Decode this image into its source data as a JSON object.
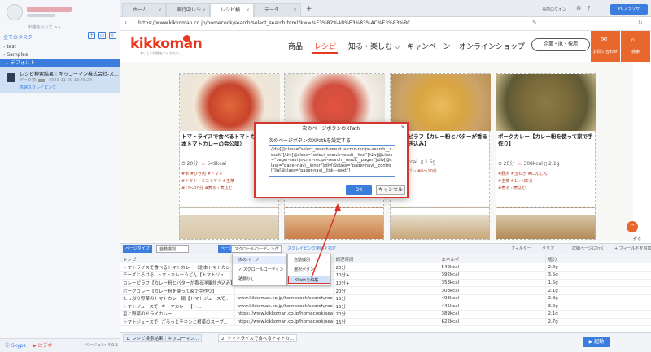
{
  "sidebar": {
    "upgrade": "料金を払って >>",
    "task_header": "全てのタスク",
    "tree": [
      "test",
      "Samples"
    ],
    "group": "デフォルト",
    "task": {
      "name": "レシピ検索結果｜キッコーマン株式会社-ス...",
      "meta_label": "データ数:",
      "date": "2023-11-09 13:45:24",
      "tag": "高速スクレイピング"
    },
    "skype": "Skype",
    "video": "ビデオ",
    "version": "バージョン: 4.0.1"
  },
  "tabs": [
    "ホーム...",
    "実行中レシ...",
    "レシピ検...",
    "データ..."
  ],
  "login": "事前ログイン",
  "pc_browser": "PCブラウザ",
  "url": "https://www.kikkoman.co.jp/homecook/search/select_search.html?kw=%E3%82%AB%E3%83%AC%E3%83%BC",
  "site": {
    "logo": "kikkoman",
    "logo_sub": "おいしい記憶をつくりたい。",
    "nav": [
      "商品",
      "レシピ",
      "知る・楽しむ ⌵",
      "キャンペーン",
      "オンラインショップ"
    ],
    "corp": "企業・IR・採用",
    "contact": "お問い合わせ",
    "search": "検索",
    "cards": [
      {
        "title": "トマトライスで食べるトマトカ...（北本トマトカレーの会公認）",
        "time": "20分",
        "kcal": "549kcal",
        "salt": "",
        "tags": [
          "#米",
          "#ひき肉",
          "#トマト",
          "#トマト・ミニトマト",
          "#主菜",
          "#11〜20分",
          "#煮る・煮込む"
        ],
        "color": "#c8432a"
      },
      {
        "title": "",
        "time": "",
        "kcal": "",
        "salt": "",
        "tags": [],
        "color": "#d24f3d"
      },
      {
        "title": "カレーピラフ【カレー粉とバターが香る洋風炊き込み】",
        "time": "",
        "kcal": "353kcal",
        "salt": "1.5g",
        "tags": [
          "#ご飯・パン",
          "#0〜10分"
        ],
        "color": "#d9a441"
      },
      {
        "title": "ポークカレー【カレー粉を使って家で手作り】",
        "time": "20分",
        "kcal": "308kcal",
        "salt": "2.1g",
        "tags": [
          "#豚肉",
          "#玉ねぎ",
          "#にんじん",
          "#主菜",
          "#11〜20分",
          "#煮る・煮込む"
        ],
        "color": "#7b6a3a"
      }
    ],
    "scroll_top": "^",
    "fold": "折る"
  },
  "dialog": {
    "title": "次のページボタンのXPath",
    "label": "次のページボタンのXPathを設定する",
    "xpath": "//div[@class=\"select_search-result js-cmn-recipe-search__result\"]/div[@class=\"select_search-result__foot\"]/div[@class=\"pager-navi js-cmn-recipe-search__result__pager\"]/div[@class=\"pager-navi__inner\"]/div[@class=\"pager-navi__control\"]/a[@class=\"pager-navi__link --next\"]",
    "ok": "OK",
    "cancel": "キャンセル"
  },
  "toolbar": {
    "page_type": "ページタイプ",
    "auto_rec": "自動識別",
    "page_select": "ページ番号の設定",
    "scroll_mode": "スクロールローディング",
    "scroll_range": "スクレイピング範囲を指定",
    "filter": "フィルター",
    "clear": "クリア",
    "detail": "詳細ページに行く",
    "add_field": "+ フィールドを追加"
  },
  "menu": {
    "primary": [
      "次のページ",
      "✓ スクロールローディング",
      "必要なし"
    ],
    "secondary": [
      "自動識別",
      "選択ボタン",
      "XPathを編集"
    ]
  },
  "table": {
    "headers": [
      "レシピ",
      "",
      "調理時間",
      "エネルギー",
      "塩分"
    ],
    "rows": [
      [
        "トマトライスで食べるトマトカレー（北本トマトカレーの...",
        "",
        "20分",
        "549kcal",
        "2.2g"
      ],
      [
        "チーズとろける! トマトカレーうどん【トマトジュ...",
        "",
        "10分+",
        "392kcal",
        "3.5g"
      ],
      [
        "カレーピラフ【カレー粉とバターが香る洋風炊き込み】",
        "",
        "10分+",
        "353kcal",
        "1.5g"
      ],
      [
        "ポークカレー【カレー粉を使って家で手作り】",
        "",
        "20分",
        "308kcal",
        "2.1g"
      ],
      [
        "たっぷり野菜のトマトカレー鍋【トマトジュースで...",
        "www.kikkoman.co.jp/homecook/search/recipe/...",
        "15分",
        "493kcal",
        "2.8g"
      ],
      [
        "トマトジュースで! キーマカレー【ト...",
        "www.kikkoman.co.jp/homecook/search/recipe/...",
        "15分",
        "445kcal",
        "3.2g"
      ],
      [
        "豆と野菜のドライカレー",
        "https://www.kikkoman.co.jp/homecook/search/recipe/...",
        "20分",
        "389kcal",
        "2.1g"
      ],
      [
        "トマトジュースで! ごろっとチキンと根菜のスープ...",
        "https://www.kikkoman.co.jp/homecook/search/recipe/...",
        "15分",
        "622kcal",
        "2.7g"
      ]
    ]
  },
  "bottom_tabs": [
    "1. レシピ検索結果｜キッコーマン...",
    "2. トマトライスで食べるトマトカ..."
  ],
  "start": "▶ 起動"
}
